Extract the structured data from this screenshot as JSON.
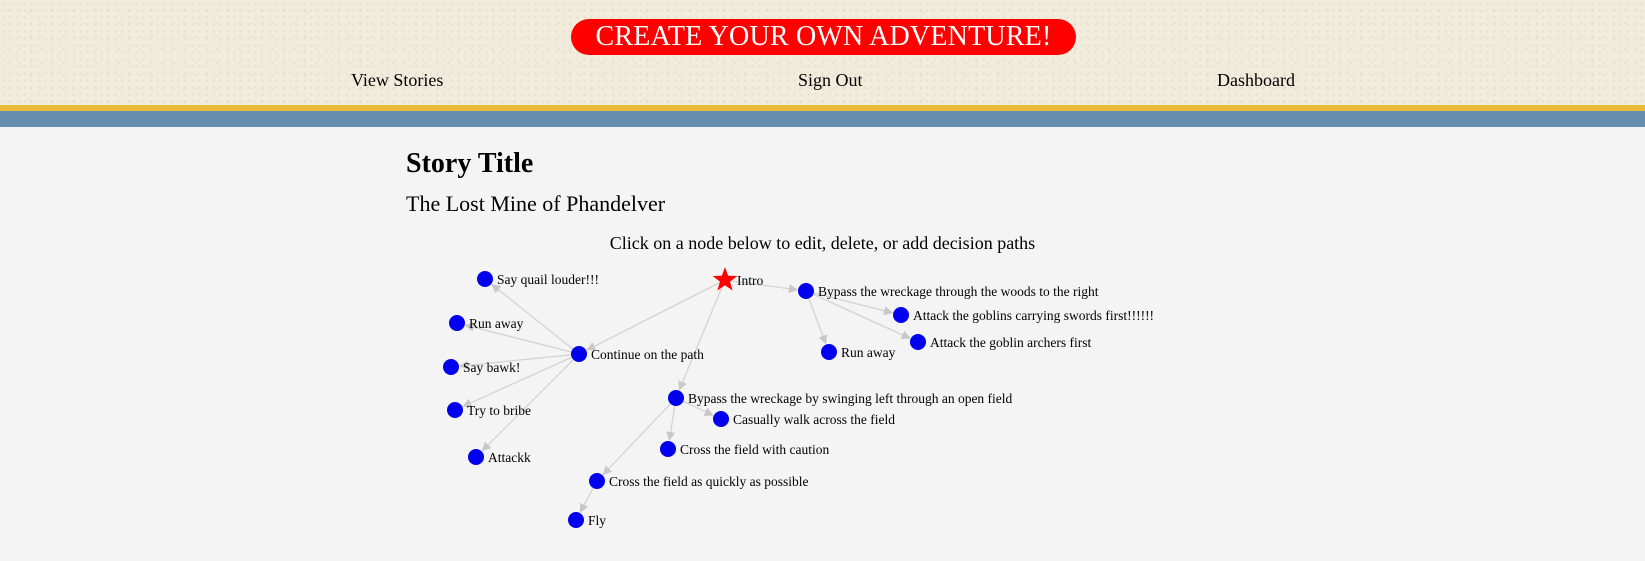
{
  "header": {
    "banner": "CREATE YOUR OWN ADVENTURE!",
    "nav": [
      "View Stories",
      "Sign Out",
      "Dashboard"
    ]
  },
  "story": {
    "heading": "Story Title",
    "title": "The Lost Mine of Phandelver",
    "instructions": "Click on a node below to edit, delete, or add decision paths"
  },
  "colors": {
    "banner": "#ff0000",
    "gold_stripe": "#e8b93a",
    "blue_stripe": "#658eaf",
    "node": "#0000ee",
    "start_node": "#ff0000",
    "edge": "#d3d3d3"
  },
  "graph": {
    "nodes": [
      {
        "id": "intro",
        "label": "Intro",
        "shape": "star"
      },
      {
        "id": "bypass_woods",
        "label": "Bypass the wreckage through the woods to the right"
      },
      {
        "id": "goblins_swords",
        "label": "Attack the goblins carrying swords first!!!!!!"
      },
      {
        "id": "goblin_archers",
        "label": "Attack the goblin archers first"
      },
      {
        "id": "run_away_2",
        "label": "Run away"
      },
      {
        "id": "continue_path",
        "label": "Continue on the path"
      },
      {
        "id": "say_quail",
        "label": "Say quail louder!!!"
      },
      {
        "id": "run_away_1",
        "label": "Run away"
      },
      {
        "id": "say_bawk",
        "label": "Say bawk!"
      },
      {
        "id": "try_bribe",
        "label": "Try to bribe"
      },
      {
        "id": "attackk",
        "label": "Attackk"
      },
      {
        "id": "bypass_field",
        "label": "Bypass the wreckage by swinging left through an open field"
      },
      {
        "id": "casually_walk",
        "label": "Casually walk across the field"
      },
      {
        "id": "cross_caution",
        "label": "Cross the field with caution"
      },
      {
        "id": "cross_quickly",
        "label": "Cross the field as quickly as possible"
      },
      {
        "id": "fly",
        "label": "Fly"
      }
    ],
    "edges": [
      [
        "intro",
        "bypass_woods"
      ],
      [
        "bypass_woods",
        "goblins_swords"
      ],
      [
        "bypass_woods",
        "goblin_archers"
      ],
      [
        "bypass_woods",
        "run_away_2"
      ],
      [
        "intro",
        "continue_path"
      ],
      [
        "continue_path",
        "say_quail"
      ],
      [
        "continue_path",
        "run_away_1"
      ],
      [
        "continue_path",
        "say_bawk"
      ],
      [
        "continue_path",
        "try_bribe"
      ],
      [
        "continue_path",
        "attackk"
      ],
      [
        "intro",
        "bypass_field"
      ],
      [
        "bypass_field",
        "casually_walk"
      ],
      [
        "bypass_field",
        "cross_caution"
      ],
      [
        "bypass_field",
        "cross_quickly"
      ],
      [
        "cross_quickly",
        "fly"
      ]
    ]
  }
}
